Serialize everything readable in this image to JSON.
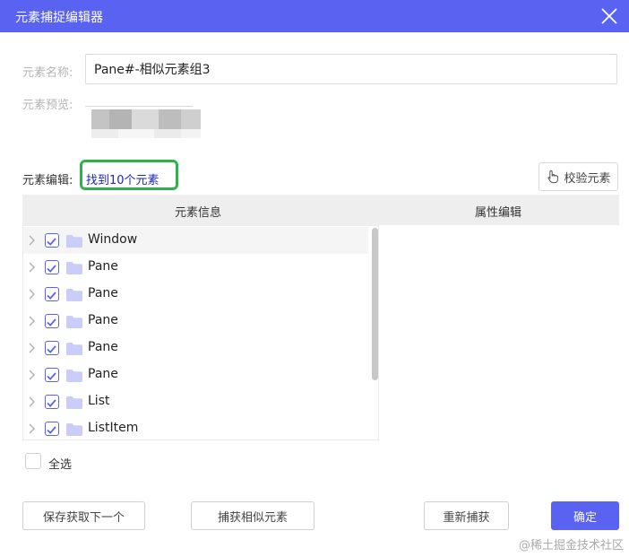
{
  "window": {
    "title": "元素捕捉编辑器"
  },
  "form": {
    "name_label": "元素名称:",
    "name_value": "Pane#-相似元素组3",
    "preview_label": "元素预览:",
    "edit_label": "元素编辑:",
    "found_text": "找到10个元素",
    "verify_label": "校验元素"
  },
  "grid": {
    "col_info": "元素信息",
    "col_props": "属性编辑",
    "rows": [
      {
        "label": "Window",
        "checked": true
      },
      {
        "label": "Pane",
        "checked": true
      },
      {
        "label": "Pane",
        "checked": true
      },
      {
        "label": "Pane",
        "checked": true
      },
      {
        "label": "Pane",
        "checked": true
      },
      {
        "label": "Pane",
        "checked": true
      },
      {
        "label": "List",
        "checked": true
      },
      {
        "label": "ListItem",
        "checked": true
      }
    ]
  },
  "select_all": {
    "label": "全选",
    "checked": false
  },
  "buttons": {
    "save_next": "保存获取下一个",
    "capture_similar": "捕获相似元素",
    "recapture": "重新捕获",
    "confirm": "确定"
  },
  "watermark": "@稀土掘金技术社区",
  "colors": {
    "accent": "#5a63f1",
    "highlight_border": "#2fb24b",
    "link": "#1d23c4"
  }
}
